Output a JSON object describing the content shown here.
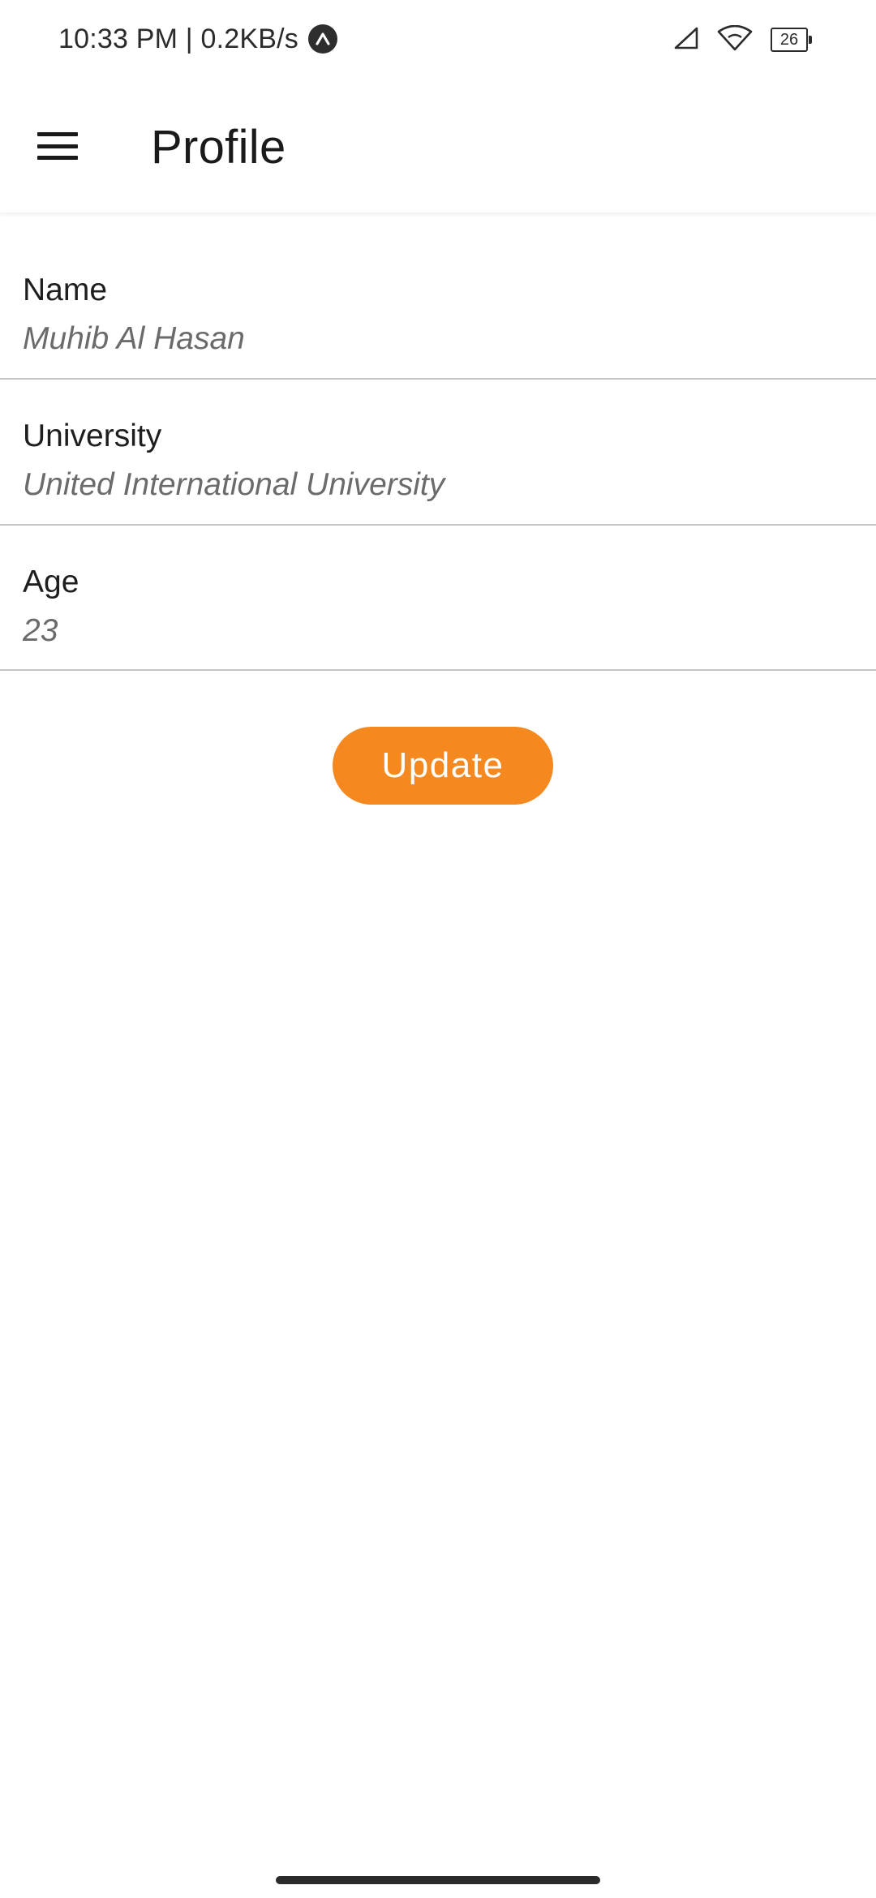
{
  "status_bar": {
    "time_speed": "10:33 PM | 0.2KB/s",
    "battery_level": "26",
    "icons": [
      "app-notification-icon",
      "signal-icon",
      "wifi-icon",
      "battery-icon"
    ]
  },
  "app_bar": {
    "title": "Profile",
    "menu_icon": "hamburger-menu-icon"
  },
  "profile": {
    "fields": [
      {
        "label": "Name",
        "value": "Muhib Al Hasan"
      },
      {
        "label": "University",
        "value": "United International University"
      },
      {
        "label": "Age",
        "value": "23"
      }
    ]
  },
  "actions": {
    "update_label": "Update"
  },
  "colors": {
    "accent": "#f5891f",
    "divider": "#c4c4c4",
    "value_text": "#6b6b6b"
  }
}
